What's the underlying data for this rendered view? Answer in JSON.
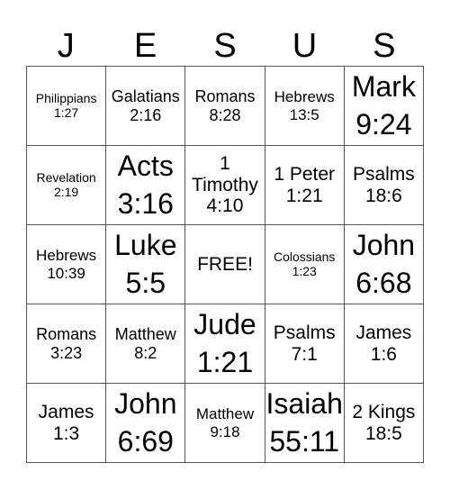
{
  "header": {
    "letters": [
      "J",
      "E",
      "S",
      "U",
      "S"
    ]
  },
  "grid": {
    "rows": [
      [
        {
          "text": "Philippians\n1:27",
          "size": "s14"
        },
        {
          "text": "Galatians\n2:16",
          "size": "s18"
        },
        {
          "text": "Romans\n8:28",
          "size": "s18"
        },
        {
          "text": "Hebrews\n13:5",
          "size": "s16"
        },
        {
          "text": "Mark\n9:24",
          "size": "s32"
        }
      ],
      [
        {
          "text": "Revelation\n2:19",
          "size": "s14"
        },
        {
          "text": "Acts\n3:16",
          "size": "s32"
        },
        {
          "text": "1\nTimothy\n4:10",
          "size": "s21"
        },
        {
          "text": "1 Peter\n1:21",
          "size": "s21"
        },
        {
          "text": "Psalms\n18:6",
          "size": "s21"
        }
      ],
      [
        {
          "text": "Hebrews\n10:39",
          "size": "s16"
        },
        {
          "text": "Luke\n5:5",
          "size": "s32"
        },
        {
          "text": "FREE!",
          "size": "s21"
        },
        {
          "text": "Colossians\n1:23",
          "size": "s14"
        },
        {
          "text": "John\n6:68",
          "size": "s32"
        }
      ],
      [
        {
          "text": "Romans\n3:23",
          "size": "s18"
        },
        {
          "text": "Matthew\n8:2",
          "size": "s18"
        },
        {
          "text": "Jude\n1:21",
          "size": "s32"
        },
        {
          "text": "Psalms\n7:1",
          "size": "s21"
        },
        {
          "text": "James\n1:6",
          "size": "s21"
        }
      ],
      [
        {
          "text": "James\n1:3",
          "size": "s21"
        },
        {
          "text": "John\n6:69",
          "size": "s32"
        },
        {
          "text": "Matthew\n9:18",
          "size": "s16"
        },
        {
          "text": "Isaiah\n55:11",
          "size": "s32"
        },
        {
          "text": "2 Kings\n18:5",
          "size": "s21"
        }
      ]
    ]
  }
}
